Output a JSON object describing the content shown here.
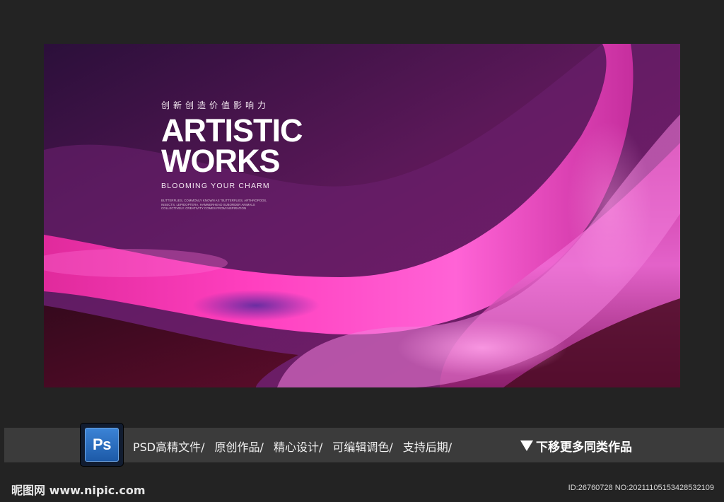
{
  "poster": {
    "tagline": "创新创造价值影响力",
    "title_line1": "ARTISTIC",
    "title_line2": "WORKS",
    "subtitle": "BLOOMING YOUR CHARM",
    "small_text": "BUTTERFLIES, COMMONLY KNOWN AS \"BUTTERFLIES, ARTHROPODS, INSECTS, LEPIDOPTERA, HAMMERHEAD SUBORDER ANIMALS COLLECTIVELY. CREATIVITY COMES FROM INSPIRATION",
    "colors": {
      "deep": "#3a0c2c",
      "magenta": "#ff2fb4",
      "pink": "#f05ccf",
      "violet": "#6a2a9c",
      "wine": "#4a0b22"
    }
  },
  "info_bar": {
    "badge_text": "Ps",
    "badge_icon": "photoshop-icon",
    "features": [
      "PSD高精文件/",
      "原创作品/",
      "精心设计/",
      "可编辑调色/",
      "支持后期/"
    ],
    "more_label": "下移更多同类作品",
    "more_icon": "triangle-down-icon"
  },
  "footer": {
    "logo": "昵图网 www.nipic.com",
    "image_id": "ID:26760728 NO:20211105153428532109"
  }
}
